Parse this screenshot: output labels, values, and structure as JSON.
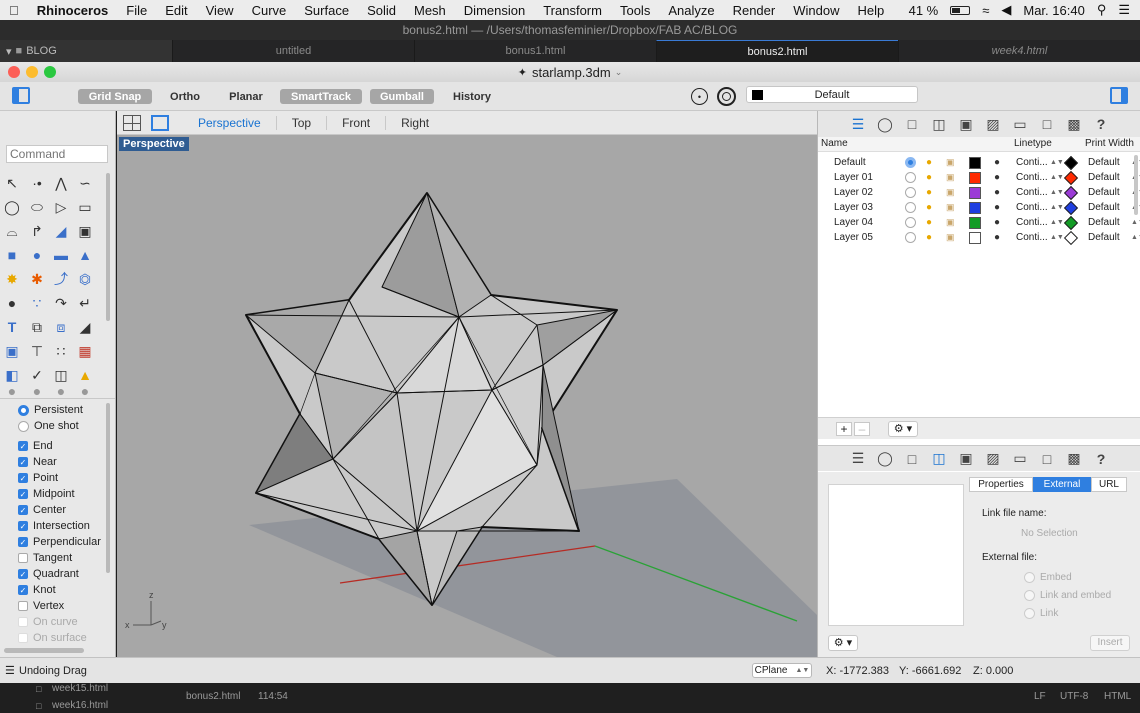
{
  "menubar": {
    "app": "Rhinoceros",
    "items": [
      "File",
      "Edit",
      "View",
      "Curve",
      "Surface",
      "Solid",
      "Mesh",
      "Dimension",
      "Transform",
      "Tools",
      "Analyze",
      "Render",
      "Window",
      "Help"
    ],
    "battery": "41 %",
    "clock": "Mar. 16:40"
  },
  "editor": {
    "title": "bonus2.html — /Users/thomasfeminier/Dropbox/FAB AC/BLOG",
    "sidebar_folder": "BLOG",
    "tabs": [
      {
        "label": "untitled"
      },
      {
        "label": "bonus1.html"
      },
      {
        "label": "bonus2.html"
      },
      {
        "label": "week4.html"
      }
    ]
  },
  "window": {
    "title": "starlamp.3dm"
  },
  "toolbar": {
    "grid_snap": "Grid Snap",
    "ortho": "Ortho",
    "planar": "Planar",
    "smarttrack": "SmartTrack",
    "gumball": "Gumball",
    "history": "History",
    "layer": "Default"
  },
  "command": {
    "placeholder": "Command"
  },
  "osnaps": {
    "mode_items": [
      {
        "label": "Persistent",
        "checked": true
      },
      {
        "label": "One shot",
        "checked": false
      }
    ],
    "items": [
      {
        "label": "End",
        "checked": true
      },
      {
        "label": "Near",
        "checked": true
      },
      {
        "label": "Point",
        "checked": true
      },
      {
        "label": "Midpoint",
        "checked": true
      },
      {
        "label": "Center",
        "checked": true
      },
      {
        "label": "Intersection",
        "checked": true
      },
      {
        "label": "Perpendicular",
        "checked": true
      },
      {
        "label": "Tangent",
        "checked": false
      },
      {
        "label": "Quadrant",
        "checked": true
      },
      {
        "label": "Knot",
        "checked": true
      },
      {
        "label": "Vertex",
        "checked": false
      },
      {
        "label": "On curve",
        "checked": false
      },
      {
        "label": "On surface",
        "checked": false
      }
    ]
  },
  "viewport": {
    "tabs": [
      "Perspective",
      "Top",
      "Front",
      "Right"
    ],
    "active_label": "Perspective",
    "axis_x": "x",
    "axis_y": "y",
    "axis_z": "z"
  },
  "layers": {
    "headers": {
      "name": "Name",
      "linetype": "Linetype",
      "print_width": "Print Width"
    },
    "rows": [
      {
        "name": "Default",
        "color": "#000000",
        "linetype": "Conti...",
        "print_color": "#000000",
        "print_width": "Default",
        "current": true
      },
      {
        "name": "Layer 01",
        "color": "#ff2a00",
        "linetype": "Conti...",
        "print_color": "#ff2a00",
        "print_width": "Default",
        "current": false
      },
      {
        "name": "Layer 02",
        "color": "#9b3bd6",
        "linetype": "Conti...",
        "print_color": "#9b3bd6",
        "print_width": "Default",
        "current": false
      },
      {
        "name": "Layer 03",
        "color": "#1f3fe0",
        "linetype": "Conti...",
        "print_color": "#1f3fe0",
        "print_width": "Default",
        "current": false
      },
      {
        "name": "Layer 04",
        "color": "#139c25",
        "linetype": "Conti...",
        "print_color": "#139c25",
        "print_width": "Default",
        "current": false
      },
      {
        "name": "Layer 05",
        "color": "#ffffff",
        "linetype": "Conti...",
        "print_color": "#ffffff",
        "print_width": "Default",
        "current": false
      }
    ]
  },
  "properties": {
    "tabs": [
      "Properties",
      "External",
      "URL"
    ],
    "link_file_label": "Link file name:",
    "no_selection": "No Selection",
    "external_file_label": "External file:",
    "options": [
      "Embed",
      "Link and embed",
      "Link"
    ],
    "insert": "Insert"
  },
  "status": {
    "message": "Undoing Drag",
    "cplane": "CPlane",
    "x": "X: -1772.383",
    "y": "Y: -6661.692",
    "z": "Z: 0.000"
  },
  "bottom": {
    "files": [
      "week15.html",
      "week16.html"
    ],
    "current_file": "bonus2.html",
    "position": "114:54",
    "eol": "LF",
    "encoding": "UTF-8",
    "language": "HTML"
  },
  "colors": {
    "accent": "#2f7fe0",
    "viewport_bg": "#a7a7a7",
    "label_bg": "#2f5c92"
  }
}
